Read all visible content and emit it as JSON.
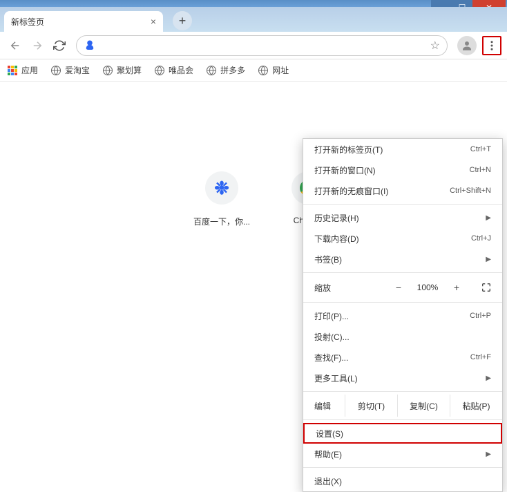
{
  "window": {
    "tab_title": "新标签页"
  },
  "omnibox": {
    "value": "",
    "placeholder": ""
  },
  "bookmarks": {
    "apps": "应用",
    "items": [
      "爱淘宝",
      "聚划算",
      "唯品会",
      "拼多多",
      "网址"
    ]
  },
  "shortcuts": [
    {
      "label": "百度一下，你..."
    },
    {
      "label": "Chrome"
    }
  ],
  "menu": {
    "new_tab": {
      "label": "打开新的标签页(T)",
      "shortcut": "Ctrl+T"
    },
    "new_window": {
      "label": "打开新的窗口(N)",
      "shortcut": "Ctrl+N"
    },
    "incognito": {
      "label": "打开新的无痕窗口(I)",
      "shortcut": "Ctrl+Shift+N"
    },
    "history": {
      "label": "历史记录(H)"
    },
    "downloads": {
      "label": "下载内容(D)",
      "shortcut": "Ctrl+J"
    },
    "bookmarks": {
      "label": "书签(B)"
    },
    "zoom": {
      "label": "缩放",
      "minus": "−",
      "value": "100%",
      "plus": "+"
    },
    "print": {
      "label": "打印(P)...",
      "shortcut": "Ctrl+P"
    },
    "cast": {
      "label": "投射(C)..."
    },
    "find": {
      "label": "查找(F)...",
      "shortcut": "Ctrl+F"
    },
    "more_tools": {
      "label": "更多工具(L)"
    },
    "edit": {
      "label": "编辑",
      "cut": "剪切(T)",
      "copy": "复制(C)",
      "paste": "粘贴(P)"
    },
    "settings": {
      "label": "设置(S)"
    },
    "help": {
      "label": "帮助(E)"
    },
    "exit": {
      "label": "退出(X)"
    }
  }
}
